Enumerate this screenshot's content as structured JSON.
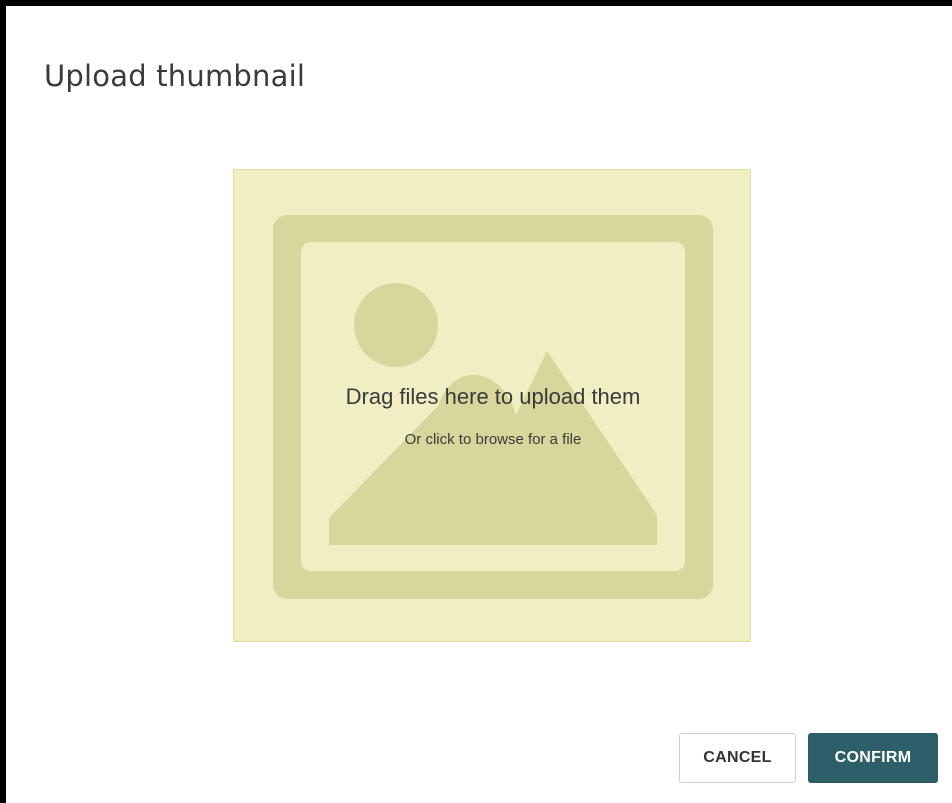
{
  "modal": {
    "title": "Upload thumbnail"
  },
  "dropzone": {
    "primary_text": "Drag files here to upload them",
    "secondary_text": "Or click to browse for a file",
    "placeholder_icon": "image-placeholder-icon"
  },
  "actions": {
    "cancel_label": "CANCEL",
    "confirm_label": "CONFIRM"
  },
  "colors": {
    "dropzone_background": "#f0efc3",
    "placeholder_icon": "#d7d79d",
    "confirm_button": "#2d5f68",
    "title_text": "#3b3b3b"
  }
}
